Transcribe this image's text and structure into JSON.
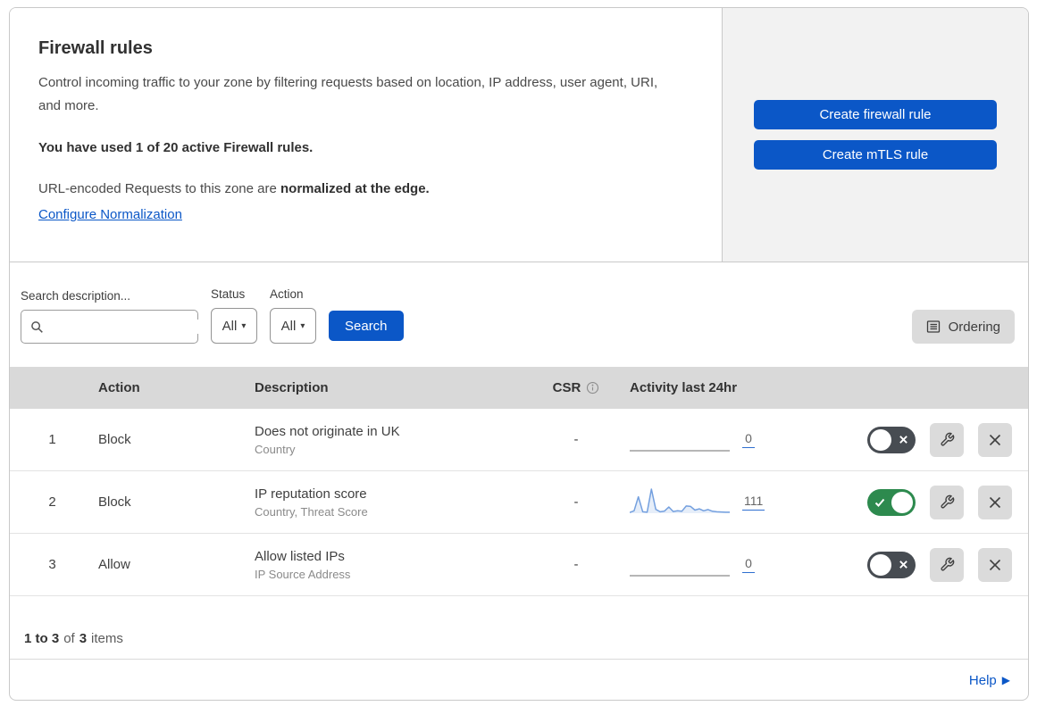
{
  "header": {
    "title": "Firewall rules",
    "description": "Control incoming traffic to your zone by filtering requests based on location, IP address, user agent, URI, and more.",
    "usage": "You have used 1 of 20 active Firewall rules.",
    "normalization_text": "URL-encoded Requests to this zone are",
    "normalization_bold": "normalized at the edge.",
    "normalization_link": "Configure Normalization"
  },
  "actions": {
    "create_firewall_rule": "Create firewall rule",
    "create_mtls_rule": "Create mTLS rule"
  },
  "filters": {
    "search_label": "Search description...",
    "status_label": "Status",
    "status_value": "All",
    "action_label": "Action",
    "action_value": "All",
    "search_button": "Search",
    "ordering_button": "Ordering"
  },
  "table": {
    "columns": {
      "action": "Action",
      "description": "Description",
      "csr": "CSR",
      "activity": "Activity last 24hr"
    },
    "rows": [
      {
        "index": "1",
        "action": "Block",
        "description": "Does not originate in UK",
        "criteria": "Country",
        "csr": "-",
        "activity_count": "0",
        "enabled": false,
        "sparkline": []
      },
      {
        "index": "2",
        "action": "Block",
        "description": "IP reputation score",
        "criteria": "Country, Threat Score",
        "csr": "-",
        "activity_count": "111",
        "enabled": true,
        "sparkline": [
          3,
          10,
          68,
          6,
          4,
          100,
          16,
          6,
          9,
          26,
          7,
          10,
          8,
          30,
          28,
          13,
          18,
          10,
          15,
          8,
          6,
          5,
          4,
          4
        ]
      },
      {
        "index": "3",
        "action": "Allow",
        "description": "Allow listed IPs",
        "criteria": "IP Source Address",
        "csr": "-",
        "activity_count": "0",
        "enabled": false,
        "sparkline": []
      }
    ]
  },
  "footer": {
    "range": "1 to 3",
    "of_word": "of",
    "total": "3",
    "items_word": "items"
  },
  "help": {
    "label": "Help"
  },
  "colors": {
    "accent_blue": "#0b57c7",
    "toggle_on_green": "#2d8a4e",
    "toggle_off_gray": "#474c52",
    "sparkline_blue": "#74a0df",
    "flat_line_gray": "#9e9e9e",
    "table_header_gray": "#d9d9d9",
    "panel_gray": "#f2f2f2"
  }
}
